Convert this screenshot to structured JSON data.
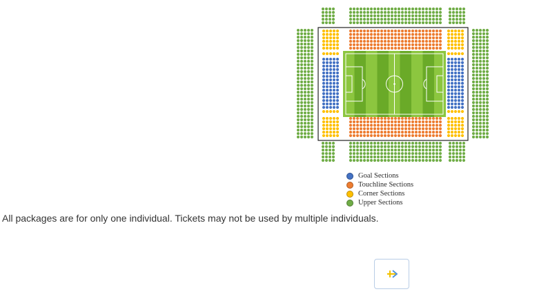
{
  "colors": {
    "goal": "#4472c4",
    "touchline": "#ed7d31",
    "corner": "#ffc000",
    "upper": "#70ad47",
    "pitch_light": "#8cc63f",
    "pitch_dark": "#6aaa28",
    "button_border": "#b8cde6"
  },
  "legend": [
    {
      "key": "goal",
      "label": "Goal Sections"
    },
    {
      "key": "touchline",
      "label": "Touchline Sections"
    },
    {
      "key": "corner",
      "label": "Corner Sections"
    },
    {
      "key": "upper",
      "label": "Upper Sections"
    }
  ],
  "notice_text": "All packages are for only one individual. Tickets may not be used by multiple individuals.",
  "next_button": {
    "icon": "arrow-right-icon"
  }
}
